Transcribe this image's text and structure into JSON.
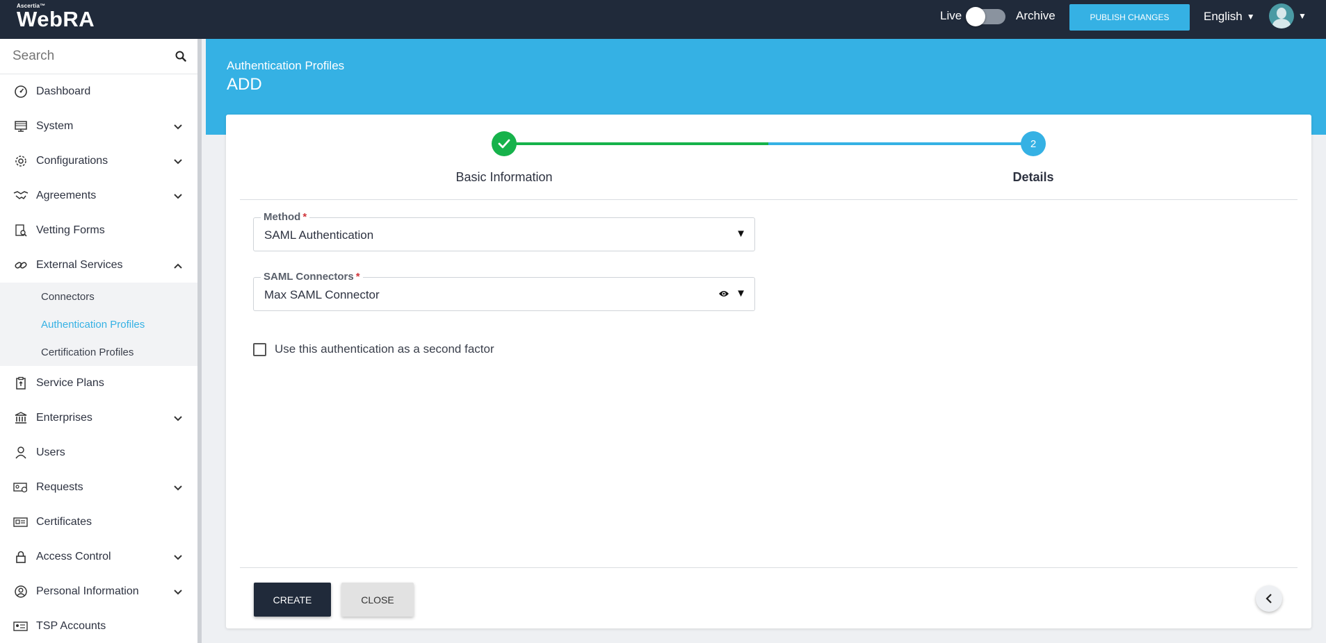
{
  "topbar": {
    "logo_small": "Ascertia™",
    "logo_big": "WebRA",
    "live_label": "Live",
    "archive_label": "Archive",
    "publish_label": "PUBLISH CHANGES",
    "language": "English"
  },
  "sidebar": {
    "search_placeholder": "Search",
    "items": [
      {
        "label": "Dashboard",
        "icon": "dashboard-icon"
      },
      {
        "label": "System",
        "icon": "system-icon"
      },
      {
        "label": "Configurations",
        "icon": "gear-icon"
      },
      {
        "label": "Agreements",
        "icon": "handshake-icon"
      },
      {
        "label": "Vetting Forms",
        "icon": "document-search-icon"
      },
      {
        "label": "External Services",
        "icon": "link-icon"
      },
      {
        "label": "Service Plans",
        "icon": "service-plan-icon"
      },
      {
        "label": "Enterprises",
        "icon": "bank-icon"
      },
      {
        "label": "Users",
        "icon": "user-icon"
      },
      {
        "label": "Requests",
        "icon": "request-icon"
      },
      {
        "label": "Certificates",
        "icon": "certificate-icon"
      },
      {
        "label": "Access Control",
        "icon": "lock-icon"
      },
      {
        "label": "Personal Information",
        "icon": "person-circle-icon"
      },
      {
        "label": "TSP Accounts",
        "icon": "tsp-icon"
      }
    ],
    "sub_items": [
      {
        "label": "Connectors"
      },
      {
        "label": "Authentication Profiles"
      },
      {
        "label": "Certification Profiles"
      }
    ]
  },
  "header": {
    "breadcrumb": "Authentication Profiles",
    "title": "ADD"
  },
  "stepper": {
    "step1_label": "Basic Information",
    "step2_label": "Details",
    "step2_number": "2"
  },
  "form": {
    "method_label": "Method",
    "method_value": "SAML Authentication",
    "connector_label": "SAML Connectors",
    "connector_value": "Max SAML Connector",
    "required_mark": "*",
    "second_factor_label": "Use this authentication as a second factor"
  },
  "actions": {
    "create_label": "CREATE",
    "close_label": "CLOSE"
  },
  "colors": {
    "brand_dark": "#202a3a",
    "accent": "#35b1e4",
    "success": "#16b24b"
  }
}
